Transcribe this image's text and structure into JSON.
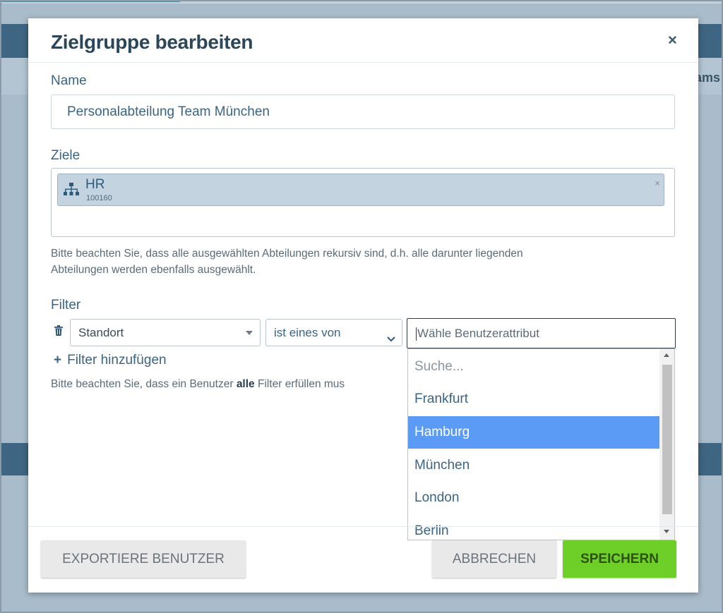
{
  "background": {
    "partial_text": "ams"
  },
  "modal": {
    "title": "Zielgruppe bearbeiten",
    "close_label": "×",
    "name": {
      "label": "Name",
      "value": "Personalabteilung Team München"
    },
    "ziele": {
      "label": "Ziele",
      "chip": {
        "title": "HR",
        "id": "100160",
        "icon": "org-chart-icon",
        "remove_label": "×"
      },
      "hint_line1": "Bitte beachten Sie, dass alle ausgewählten Abteilungen rekursiv sind, d.h. alle darunter liegenden",
      "hint_line2": "Abteilungen werden ebenfalls ausgewählt."
    },
    "filter": {
      "label": "Filter",
      "attribute_select": "Standort",
      "operator_select": "ist eines von",
      "value_placeholder": "Wähle Benutzerattribut",
      "add_label": "Filter hinzufügen",
      "hint_before": "Bitte beachten Sie, dass ein Benutzer ",
      "hint_bold": "alle",
      "hint_after": " Filter erfüllen mus"
    },
    "dropdown": {
      "search_placeholder": "Suche...",
      "options": [
        "Frankfurt",
        "Hamburg",
        "München",
        "London",
        "Berlin"
      ],
      "highlighted": "Hamburg"
    },
    "buttons": {
      "export": "EXPORTIERE BENUTZER",
      "cancel": "ABBRECHEN",
      "save": "SPEICHERN"
    }
  },
  "colors": {
    "accent": "#3b6483",
    "save_green": "#6fcf29",
    "highlight_blue": "#5b9bf5",
    "chip_bg": "#c3d3df"
  }
}
